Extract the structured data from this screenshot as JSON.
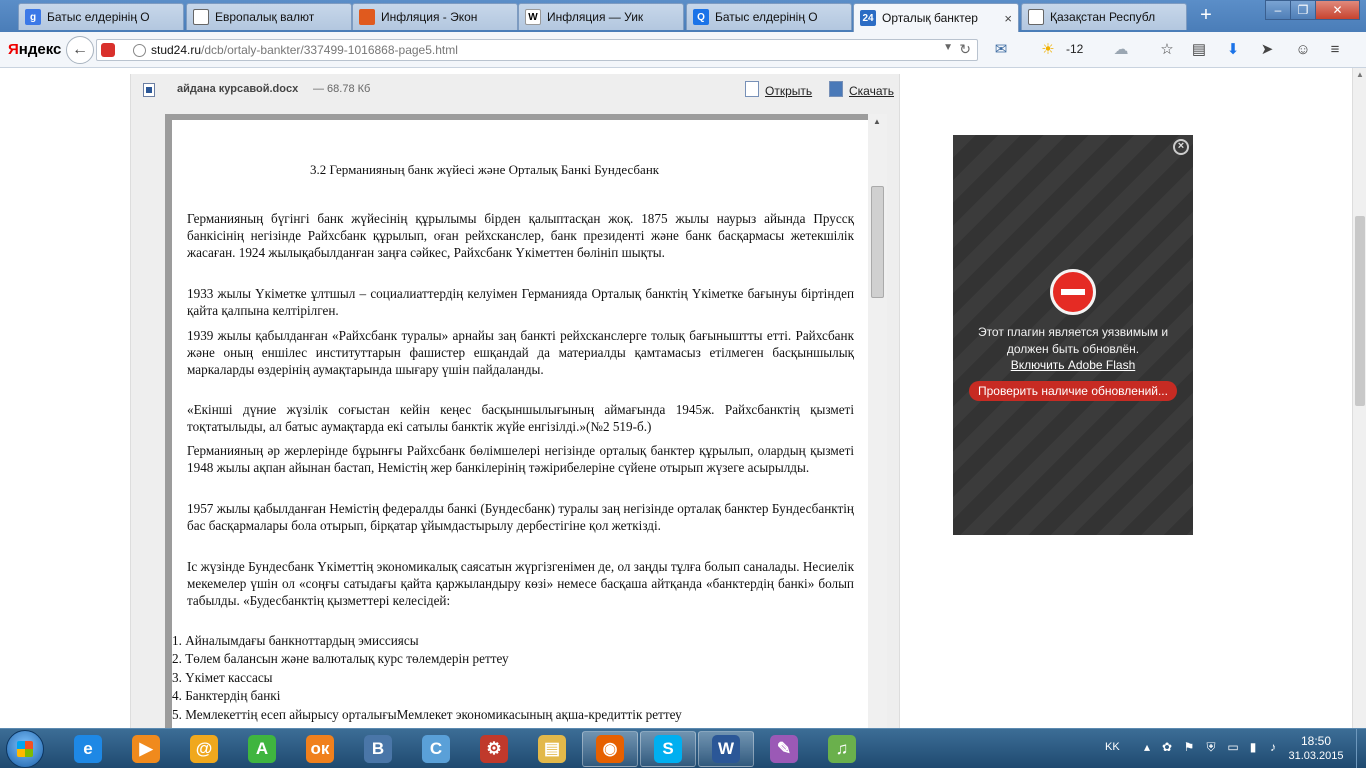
{
  "tabs": [
    {
      "title": "Батыс елдерінің О",
      "icon": "google-icon",
      "color": "#3b78e7",
      "glyph": "g"
    },
    {
      "title": "Европалық валют",
      "icon": "document-icon",
      "color": "#666666",
      "glyph": ""
    },
    {
      "title": "Инфляция - Экон",
      "icon": "pinwheel-icon",
      "color": "#e05a1e",
      "glyph": ""
    },
    {
      "title": "Инфляция — Уик",
      "icon": "wikipedia-icon",
      "color": "#ffffff",
      "glyph": "W"
    },
    {
      "title": "Батыс елдерінің О",
      "icon": "search-icon",
      "color": "#1a73e8",
      "glyph": "Q"
    },
    {
      "title": "Орталық банктер",
      "icon": "stud24-icon",
      "color": "#2b6cc4",
      "glyph": "24"
    },
    {
      "title": "Қазақстан Республ",
      "icon": "document-icon",
      "color": "#666666",
      "glyph": ""
    }
  ],
  "browser": {
    "logo_first": "Я",
    "logo_rest": "ндекс",
    "url_host": "stud24.ru",
    "url_path": "/dcb/ortaly-bankter/337499-1016868-page5.html",
    "temperature": "-12"
  },
  "file": {
    "name": "айдана курсавой.docx",
    "size": "— 68.78 Кб",
    "open_label": "Открыть",
    "download_label": "Скачать"
  },
  "document": {
    "heading": "3.2   Германияның банк жүйесі және Орталық Банкі Бундесбанк",
    "paragraphs": [
      "Германияның бүгінгі банк жүйесінің құрылымы бірден қалыптасқан жоқ. 1875 жылы наурыз айында Пруссқ банкісінің негізінде Райхсбанк құрылып, оған рейхсканслер, банк президенті және банк басқармасы жетекшілік жасаған. 1924 жылықабылданған заңға сәйкес, Райхсбанк Үкіметтен бөлініп шықты.",
      "1933 жылы Үкіметке ұлтшыл – социалиаттердің келуімен Германияда Орталық банктің Үкіметке бағынуы біртіндеп қайта қалпына келтірілген.",
      "1939 жылы қабылданған «Райхсбанк туралы» арнайы заң банкті рейхсканслерге толық бағыныштты етті. Райхсбанк және оның еншілес институттарын фашистер ешқандай да материалды қамтамасыз етілмеген басқыншылық маркаларды өздерінің аумақтарында шығару үшін пайдаланды.",
      "«Екінші дүние жүзілік соғыстан кейін кеңес басқыншылығының аймағында 1945ж. Райхсбанктің қызметі тоқтатылыды, ал батыс аумақтарда екі сатылы банктік жүйе енгізілді.»(№2 519-б.)",
      "Германияның әр жерлерінде бұрынғы Райхсбанк бөлімшелері негізінде орталық банктер құрылып, олардың қызметі 1948 жылы ақпан айынан бастап, Немістің жер банкілерінің тәжірибелеріне сүйене отырып жүзеге асырылды.",
      "1957 жылы қабылданған Немістің федералды банкі (Бундесбанк) туралы заң негізінде орталақ банктер Бундесбанктің бас басқармалары бола отырып, бірқатар ұйымдастырылу дербестігіне қол жеткізді.",
      "Іс жүзінде Бундесбанк Үкіметтің экономикалық саясатын жүргізгенімен де, ол заңды тұлға болып саналады. Несиелік мекемелер үшін ол «соңғы сатыдағы қайта қаржыландыру көзі» немесе басқаша айтқанда «банктердің банкі» болып табылды. «Будесбанктің қызметтері келесідей:"
    ],
    "list": [
      "1. Айналымдағы банкноттардың эмиссиясы",
      "2. Төлем балансын және валюталық курс төлемдерін реттеу",
      "3. Үкімет кассасы",
      "4. Банктердің банкі",
      "5. Мемлекеттің есеп айырысу орталығыМемлекет экономикасының ақша-кредиттік реттеу"
    ]
  },
  "flash": {
    "message_line1": "Этот плагин является уязвимым и",
    "message_line2": "должен быть обновлён.",
    "enable_link": "Включить Adobe Flash",
    "update_button": "Проверить наличие обновлений..."
  },
  "taskbar": {
    "apps": [
      {
        "name": "internet-explorer",
        "color": "#1e88e5",
        "glyph": "e",
        "open": false
      },
      {
        "name": "media-player",
        "color": "#f08a1d",
        "glyph": "▶",
        "open": false
      },
      {
        "name": "mail-agent",
        "color": "#f0a81d",
        "glyph": "@",
        "open": false
      },
      {
        "name": "a-app",
        "color": "#3fb53f",
        "glyph": "A",
        "open": false
      },
      {
        "name": "odnoklassniki",
        "color": "#f0801d",
        "glyph": "ок",
        "open": false
      },
      {
        "name": "vkontakte",
        "color": "#4a76a8",
        "glyph": "B",
        "open": false
      },
      {
        "name": "icq",
        "color": "#5aa0d8",
        "glyph": "C",
        "open": false
      },
      {
        "name": "gear-app",
        "color": "#c0392b",
        "glyph": "⚙",
        "open": false
      },
      {
        "name": "file-explorer",
        "color": "#e2b84a",
        "glyph": "▤",
        "open": false
      },
      {
        "name": "firefox",
        "color": "#e66000",
        "glyph": "◉",
        "open": true
      },
      {
        "name": "skype",
        "color": "#00aff0",
        "glyph": "S",
        "open": true
      },
      {
        "name": "word",
        "color": "#2b5797",
        "glyph": "W",
        "open": true
      },
      {
        "name": "paint",
        "color": "#9b59b6",
        "glyph": "✎",
        "open": false
      },
      {
        "name": "music-app",
        "color": "#6ab04c",
        "glyph": "♫",
        "open": false
      }
    ],
    "language": "KK",
    "time": "18:50",
    "date": "31.03.2015"
  },
  "colors": {
    "tab_strip": "#4a7db8",
    "flash_button": "#c72b23",
    "taskbar": "#1f4a70"
  }
}
